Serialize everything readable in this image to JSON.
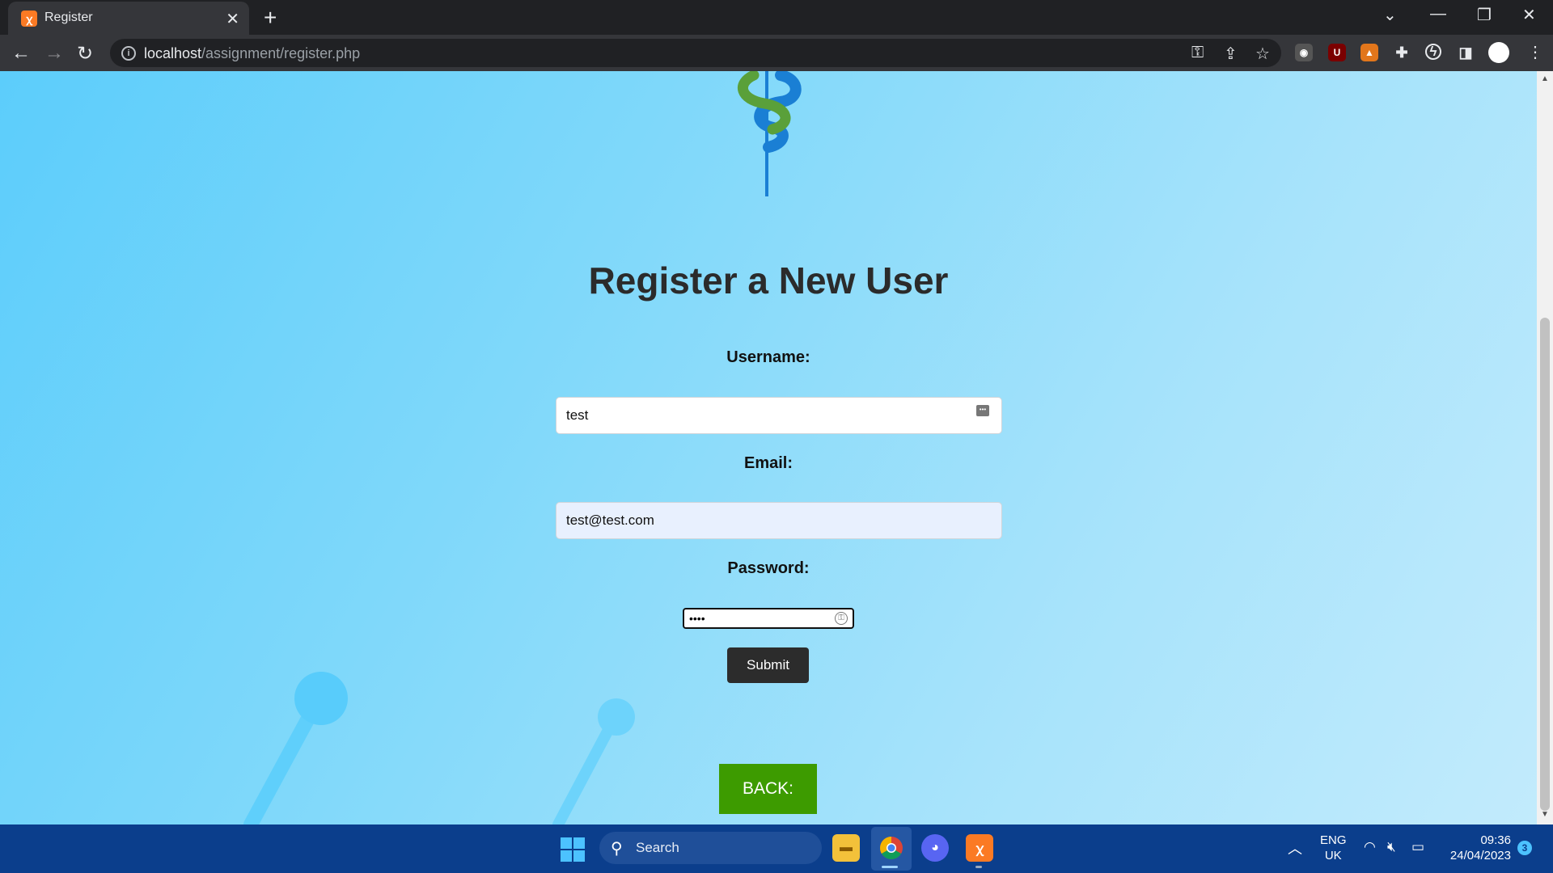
{
  "browser": {
    "tab_title": "Register",
    "tab_favicon": "xampp-icon",
    "new_tab_label": "+",
    "url_host": "localhost",
    "url_path": "/assignment/register.php"
  },
  "page": {
    "title": "Register a New User",
    "username_label": "Username:",
    "username_value": "test",
    "email_label": "Email:",
    "email_value": "test@test.com",
    "password_label": "Password:",
    "password_value": "test",
    "submit_label": "Submit",
    "back_label": "BACK:"
  },
  "colors": {
    "page_gradient_start": "#5ccdfb",
    "page_gradient_end": "#c2ebfc",
    "submit_button": "#2c2c2c",
    "back_button": "#3d9b00",
    "title_text": "#2b2b2b",
    "taskbar": "#0b3e8c"
  },
  "taskbar": {
    "search_label": "Search",
    "lang_line1": "ENG",
    "lang_line2": "UK",
    "time": "09:36",
    "date": "24/04/2023",
    "notification_count": "3",
    "apps": [
      "file-explorer-icon",
      "chrome-icon",
      "discord-icon",
      "xampp-icon"
    ]
  }
}
